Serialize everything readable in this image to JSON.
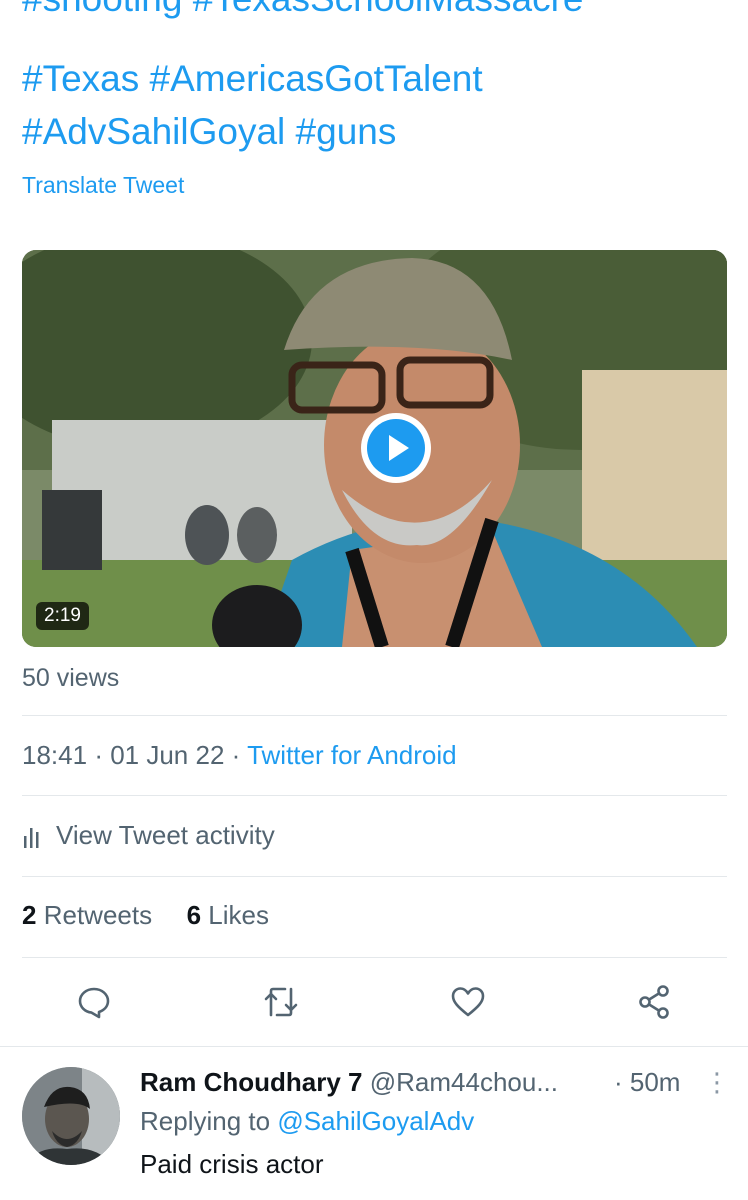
{
  "tweet": {
    "hashtags_line1": "#shooting #TexasSchoolMassacre",
    "hashtags_line2": "#Texas #AmericasGotTalent",
    "hashtags_line3": "#AdvSahilGoyal #guns",
    "translate": "Translate Tweet",
    "video": {
      "duration": "2:19",
      "play_icon": "play-icon"
    },
    "views": "50 views",
    "time": "18:41",
    "date": "01 Jun 22",
    "source": "Twitter for Android",
    "activity_label": "View Tweet activity",
    "retweets_count": "2",
    "retweets_label": "Retweets",
    "likes_count": "6",
    "likes_label": "Likes"
  },
  "actions": [
    "reply-icon",
    "retweet-icon",
    "like-icon",
    "share-icon"
  ],
  "reply": {
    "name": "Ram Choudhary 7",
    "handle": "@Ram44chou...",
    "time": "50m",
    "replying_prefix": "Replying to",
    "replying_to": "@SahilGoyalAdv",
    "text": "Paid crisis actor"
  },
  "colors": {
    "accent": "#1d9bf0",
    "secondary_text": "#536471",
    "text": "#0f1419",
    "divider": "#e4e8eb"
  }
}
